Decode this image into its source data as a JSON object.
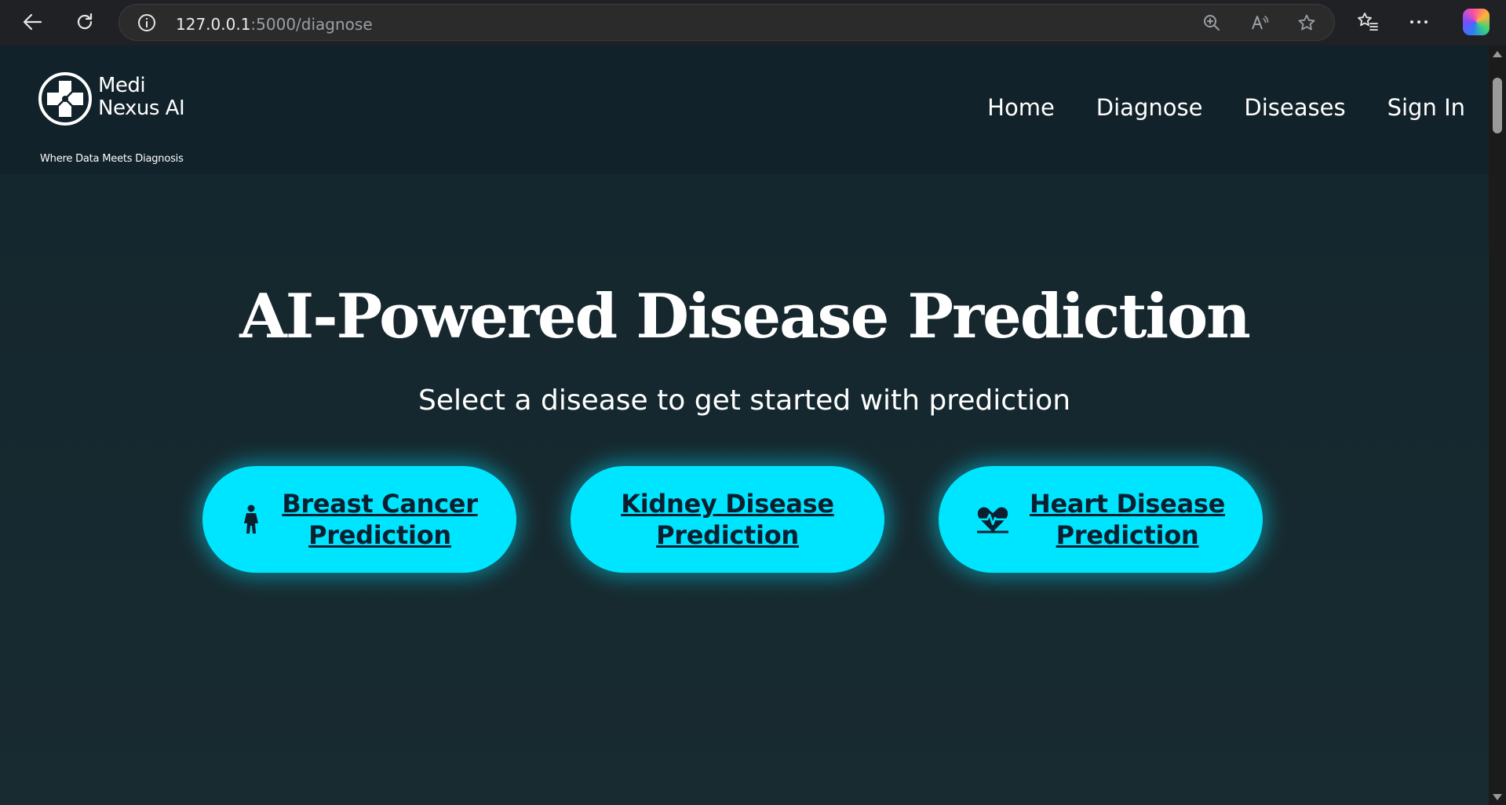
{
  "browser": {
    "url_host": "127.0.0.1",
    "url_rest": ":5000/diagnose",
    "icons": [
      "back-icon",
      "reload-icon",
      "info-icon",
      "zoom-icon",
      "read-aloud-icon",
      "star-icon",
      "favorites-icon",
      "more-icon",
      "copilot-icon"
    ]
  },
  "header": {
    "logo": {
      "name_line1": "Medi",
      "name_line2": "Nexus AI",
      "tagline": "Where Data Meets Diagnosis"
    },
    "nav": [
      "Home",
      "Diagnose",
      "Diseases",
      "Sign In"
    ]
  },
  "hero": {
    "title": "AI-Powered Disease Prediction",
    "subtitle": "Select a disease to get started with prediction"
  },
  "buttons": {
    "breast": {
      "line1": "Breast Cancer",
      "line2": "Prediction",
      "icon": "female-figure-icon"
    },
    "kidney": {
      "line1": "Kidney Disease",
      "line2": "Prediction"
    },
    "heart": {
      "line1": "Heart Disease",
      "line2": "Prediction",
      "icon": "heart-pulse-icon"
    }
  },
  "colors": {
    "accent": "#00e5ff",
    "background": "#162a31",
    "header": "#12222a",
    "text": "#ffffff"
  }
}
